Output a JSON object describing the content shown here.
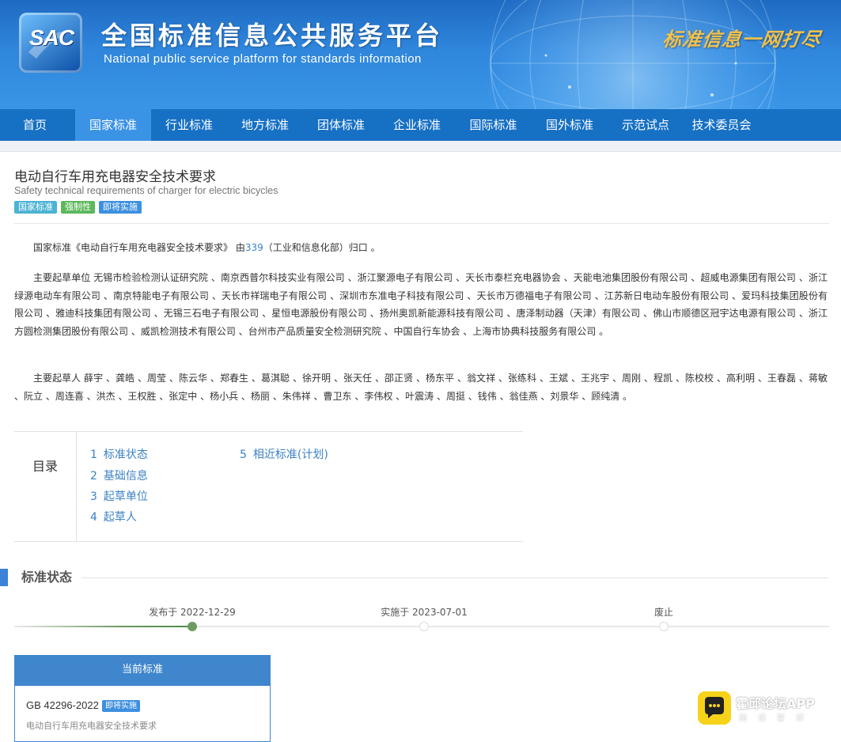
{
  "header": {
    "logo_text": "SAC",
    "title_cn": "全国标准信息公共服务平台",
    "title_en": "National public service platform  for standards information",
    "slogan": "标准信息一网打尽"
  },
  "nav": {
    "items": [
      {
        "label": "首页",
        "active": false
      },
      {
        "label": "国家标准",
        "active": true
      },
      {
        "label": "行业标准",
        "active": false
      },
      {
        "label": "地方标准",
        "active": false
      },
      {
        "label": "团体标准",
        "active": false
      },
      {
        "label": "企业标准",
        "active": false
      },
      {
        "label": "国际标准",
        "active": false
      },
      {
        "label": "国外标准",
        "active": false
      },
      {
        "label": "示范试点",
        "active": false
      },
      {
        "label": "技术委员会",
        "active": false
      }
    ]
  },
  "standard": {
    "title": "电动自行车用充电器安全技术要求",
    "title_en": "Safety technical requirements of charger for electric bicycles",
    "tags": [
      "国家标准",
      "强制性",
      "即将实施"
    ],
    "tag_colors": [
      "#4bb3d4",
      "#5cb85c",
      "#3d8fe0"
    ]
  },
  "intro": {
    "prefix": "国家标准《电动自行车用充电器安全技术要求》 由",
    "tc_link": "339",
    "suffix": "（工业和信息化部）归口 。"
  },
  "drafting_units": {
    "text": "主要起草单位 无锡市检验检测认证研究院 、南京西普尔科技实业有限公司 、浙江聚源电子有限公司 、天长市泰栏充电器协会 、天能电池集团股份有限公司 、超威电源集团有限公司 、浙江绿源电动车有限公司 、南京特能电子有限公司 、天长市祥瑞电子有限公司 、深圳市东准电子科技有限公司 、天长市万德福电子有限公司 、江苏新日电动车股份有限公司 、爱玛科技集团股份有限公司 、雅迪科技集团有限公司 、无锡三石电子有限公司 、星恒电源股份有限公司 、扬州奥凯新能源科技有限公司 、唐泽制动器（天津）有限公司 、佛山市顺德区冠宇达电源有限公司 、浙江方圆检测集团股份有限公司 、威凯检测技术有限公司 、台州市产品质量安全检测研究院 、中国自行车协会 、上海市协典科技服务有限公司 。"
  },
  "drafters": {
    "text": "主要起草人 薛宇 、龚皓 、周莹 、陈云华 、郑春生 、葛淇聪 、徐开明 、张天任 、邵正贤 、杨东平 、翁文祥 、张练科 、王斌 、王兆宇 、周刚 、程凯 、陈校校 、高利明 、王春磊 、蒋敏 、阮立 、周连喜 、洪杰 、王权胜 、张定中 、杨小兵 、杨丽 、朱伟祥 、曹卫东 、李伟权 、叶震涛 、周挺 、钱伟 、翁佳燕 、刘景华 、顾纯清 。"
  },
  "toc": {
    "label": "目录",
    "items": [
      {
        "num": "1",
        "label": "标准状态"
      },
      {
        "num": "2",
        "label": "基础信息"
      },
      {
        "num": "3",
        "label": "起草单位"
      },
      {
        "num": "4",
        "label": "起草人"
      },
      {
        "num": "5",
        "label": "相近标准(计划)"
      }
    ]
  },
  "status_section": {
    "title": "标准状态",
    "timeline": [
      {
        "label": "发布于 2022-12-29",
        "done": true
      },
      {
        "label": "实施于 2023-07-01",
        "done": false
      },
      {
        "label": "废止",
        "done": false
      }
    ],
    "progress_stage": 1
  },
  "current_card": {
    "header": "当前标准",
    "code": "GB 42296-2022",
    "badge": "即将实施",
    "name": "电动自行车用充电器安全技术要求"
  },
  "watermark": {
    "title": "霍邱论坛APP",
    "subtitle": "阅读霍邱"
  },
  "colors": {
    "nav_bg": "#1670c4",
    "nav_active": "#3b93e5",
    "link": "#3b82c4",
    "accent": "#3f86cc",
    "done_green": "#6c9c62"
  }
}
